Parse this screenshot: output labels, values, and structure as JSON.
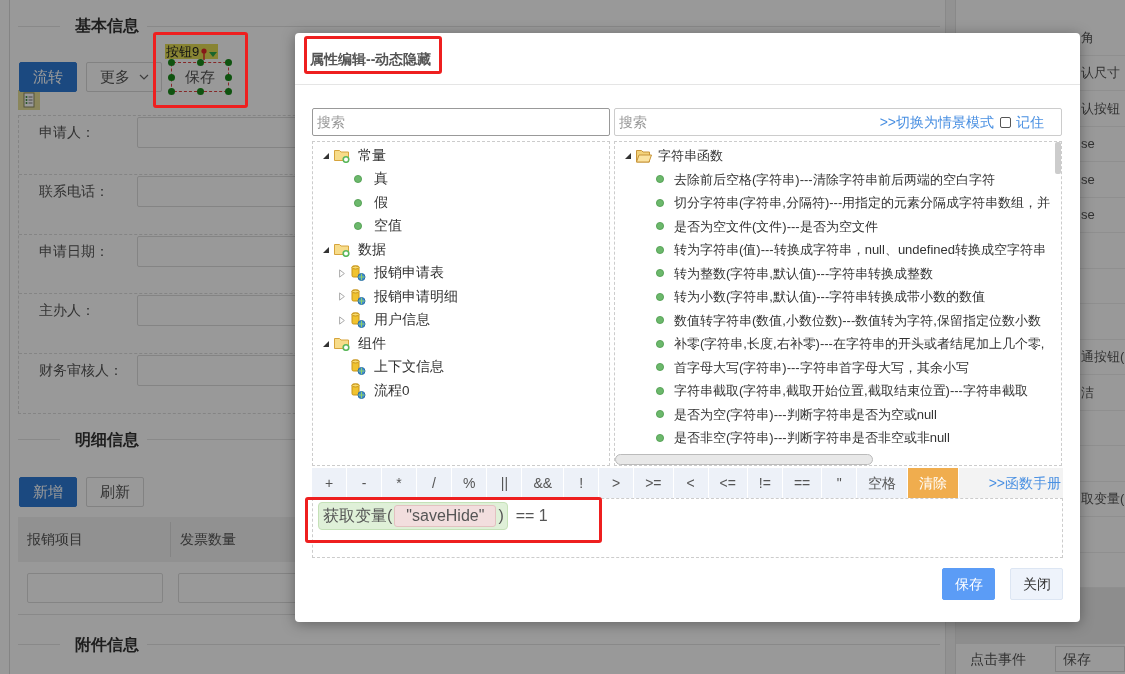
{
  "page": {
    "basic_info": {
      "title": "基本信息",
      "buttons": [
        {
          "label": "流转",
          "kind": "primary",
          "selected": false
        },
        {
          "label": "更多",
          "kind": "dropdown",
          "selected": false
        },
        {
          "label": "保存",
          "kind": "default",
          "selected": true,
          "tag": "按钮9"
        }
      ],
      "fields": [
        {
          "label": "申请人："
        },
        {
          "label": "联系电话："
        },
        {
          "label": "申请日期："
        },
        {
          "label": "主办人："
        },
        {
          "label": "财务审核人："
        }
      ]
    },
    "detail_info": {
      "title": "明细信息",
      "buttons": [
        {
          "label": "新增",
          "kind": "primary",
          "selected": false
        },
        {
          "label": "刷新",
          "kind": "default",
          "selected": false
        }
      ],
      "table": {
        "columns": [
          "报销项目",
          "发票数量"
        ]
      }
    },
    "attachment_info": {
      "title": "附件信息"
    },
    "properties": {
      "rows": [
        {
          "value": "角"
        },
        {
          "value": "认尺寸"
        },
        {
          "value": "认按钮"
        },
        {
          "value": "se"
        },
        {
          "value": "se"
        },
        {
          "value": "se"
        },
        {},
        {},
        {},
        {
          "value": "通按钮("
        },
        {
          "value": "洁"
        },
        {},
        {},
        {
          "value": "取变量("
        },
        {},
        {}
      ],
      "event": {
        "label": "点击事件",
        "value": "保存"
      }
    }
  },
  "dialog": {
    "title": "属性编辑--动态隐藏",
    "left_search": {
      "placeholder": "搜索"
    },
    "right_search": {
      "placeholder": "搜索",
      "mode_link": ">>切换为情景模式",
      "remember": {
        "label": "记住",
        "checked": false
      }
    },
    "variable_tree": [
      {
        "label": "常量",
        "kind": "group",
        "expanded": true,
        "children": [
          {
            "label": "真",
            "kind": "value"
          },
          {
            "label": "假",
            "kind": "value"
          },
          {
            "label": "空值",
            "kind": "value"
          }
        ]
      },
      {
        "label": "数据",
        "kind": "group",
        "expanded": true,
        "children": [
          {
            "label": "报销申请表",
            "kind": "source",
            "expanded": false
          },
          {
            "label": "报销申请明细",
            "kind": "source",
            "expanded": false
          },
          {
            "label": "用户信息",
            "kind": "source",
            "expanded": false
          }
        ]
      },
      {
        "label": "组件",
        "kind": "group",
        "expanded": true,
        "children": [
          {
            "label": "上下文信息",
            "kind": "source"
          },
          {
            "label": "流程0",
            "kind": "source"
          }
        ]
      }
    ],
    "function_tree": [
      {
        "label": "字符串函数",
        "kind": "category",
        "expanded": true,
        "children": [
          {
            "label": "去除前后空格(字符串)---清除字符串前后两端的空白字符",
            "kind": "function"
          },
          {
            "label": "切分字符串(字符串,分隔符)---用指定的元素分隔成字符串数组，并",
            "kind": "function"
          },
          {
            "label": "是否为空文件(文件)---是否为空文件",
            "kind": "function"
          },
          {
            "label": "转为字符串(值)---转换成字符串，null、undefined转换成空字符串",
            "kind": "function"
          },
          {
            "label": "转为整数(字符串,默认值)---字符串转换成整数",
            "kind": "function"
          },
          {
            "label": "转为小数(字符串,默认值)---字符串转换成带小数的数值",
            "kind": "function"
          },
          {
            "label": "数值转字符串(数值,小数位数)---数值转为字符,保留指定位数小数",
            "kind": "function"
          },
          {
            "label": "补零(字符串,长度,右补零)---在字符串的开头或者结尾加上几个零,",
            "kind": "function"
          },
          {
            "label": "首字母大写(字符串)---字符串首字母大写，其余小写",
            "kind": "function"
          },
          {
            "label": "字符串截取(字符串,截取开始位置,截取结束位置)---字符串截取",
            "kind": "function"
          },
          {
            "label": "是否为空(字符串)---判断字符串是否为空或null",
            "kind": "function"
          },
          {
            "label": "是否非空(字符串)---判断字符串是否非空或非null",
            "kind": "function"
          }
        ]
      }
    ],
    "operators": [
      {
        "label": "+",
        "kind": "operator"
      },
      {
        "label": "-",
        "kind": "operator"
      },
      {
        "label": "*",
        "kind": "operator"
      },
      {
        "label": "/",
        "kind": "operator"
      },
      {
        "label": "%",
        "kind": "operator"
      },
      {
        "label": "||",
        "kind": "operator"
      },
      {
        "label": "&&",
        "kind": "operator"
      },
      {
        "label": "!",
        "kind": "operator"
      },
      {
        "label": ">",
        "kind": "operator"
      },
      {
        "label": ">=",
        "kind": "operator"
      },
      {
        "label": "<",
        "kind": "operator"
      },
      {
        "label": "<=",
        "kind": "operator"
      },
      {
        "label": "!=",
        "kind": "operator"
      },
      {
        "label": "==",
        "kind": "operator"
      },
      {
        "label": "\"",
        "kind": "operator"
      },
      {
        "label": "空格",
        "kind": "operator"
      },
      {
        "label": "清除",
        "kind": "clear"
      }
    ],
    "manual_link": ">>函数手册",
    "expression": {
      "function": "获取变量(",
      "argument": "\"saveHide\"",
      "closing": ")",
      "tail": "== 1"
    },
    "buttons": [
      {
        "label": "保存",
        "kind": "primary"
      },
      {
        "label": "关闭",
        "kind": "default"
      }
    ]
  }
}
